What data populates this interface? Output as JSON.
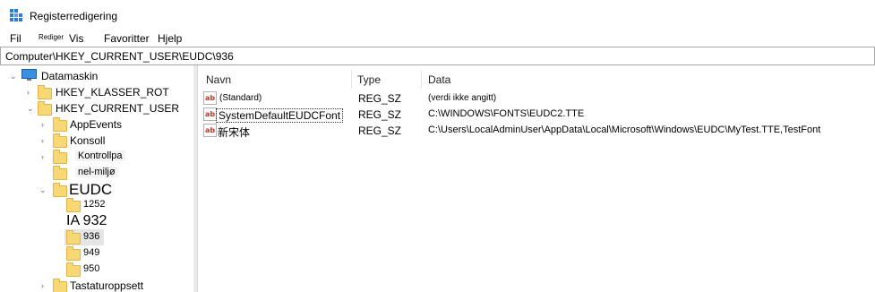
{
  "window": {
    "title": "Registerredigering",
    "icon": "registry-editor-icon"
  },
  "menu": [
    {
      "label": "Fil"
    },
    {
      "label": "Rediger"
    },
    {
      "label": "Vis"
    },
    {
      "label": "Favoritter"
    },
    {
      "label": "Hjelp"
    }
  ],
  "address": {
    "path": "Computer\\HKEY_CURRENT_USER\\EUDC\\936"
  },
  "tree": {
    "root": {
      "label": "Datamaskin",
      "icon": "computer-icon"
    },
    "items": [
      {
        "label": "HKEY_KLASSER_ROT"
      },
      {
        "label": "HKEY_CURRENT_USER"
      },
      {
        "label": "AppEvents"
      },
      {
        "label": "Konsoll"
      },
      {
        "label": "Kontrollpa"
      },
      {
        "label": "nel-miljø"
      },
      {
        "label": "EUDC"
      },
      {
        "label": "1252"
      },
      {
        "label": "IA 932"
      },
      {
        "label": "936"
      },
      {
        "label": "949"
      },
      {
        "label": "950"
      },
      {
        "label": "Tastaturoppsett"
      }
    ]
  },
  "list": {
    "columns": [
      "Navn",
      "Type",
      "Data"
    ],
    "rows": [
      {
        "name": "(Standard)",
        "type": "REG_SZ",
        "data": "(verdi ikke angitt)"
      },
      {
        "name": "SystemDefaultEUDCFont",
        "type": "REG_SZ",
        "data": "C:\\WINDOWS\\FONTS\\EUDC2.TTE"
      },
      {
        "name": "新宋体",
        "type": "REG_SZ",
        "data": "C:\\Users\\LocalAdminUser\\AppData\\Local\\Microsoft\\Windows\\EUDC\\MyTest.TTE,TestFont"
      }
    ]
  },
  "colors": {
    "selection": "#e5e5e5",
    "folder": "#f8d775"
  }
}
